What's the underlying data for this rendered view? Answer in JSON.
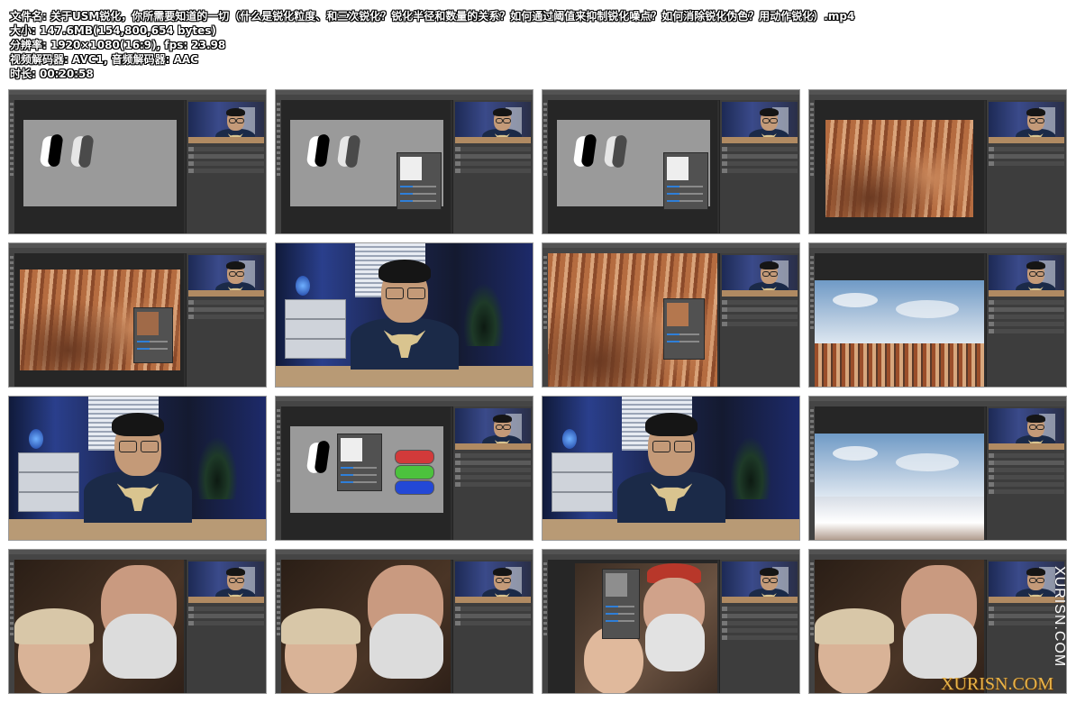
{
  "meta": {
    "filename": "文件名: 关于USM锐化，你所需要知道的一切（什么是锐化粒度、和三次锐化？锐化半径和数量的关系？如何通过阈值来抑制锐化噪点？如何消除锐化伪色？用动作锐化）.mp4",
    "size": "大小: 147.6MB(154,800,654 bytes)",
    "resolution": "分辨率: 1920×1080(16:9), fps: 23.98",
    "codec": "视频解码器: AVC1, 音频解码器: AAC",
    "duration": "时长: 00:20:58"
  },
  "thumbnails": [
    {
      "scene": "ps-shapes-gray"
    },
    {
      "scene": "ps-shapes-dialog"
    },
    {
      "scene": "ps-shapes-dialog"
    },
    {
      "scene": "ps-canyon-small"
    },
    {
      "scene": "ps-canyon-dialog"
    },
    {
      "scene": "presenter"
    },
    {
      "scene": "ps-canyon-zoom"
    },
    {
      "scene": "ps-sky-canyon"
    },
    {
      "scene": "presenter"
    },
    {
      "scene": "ps-shapes-color"
    },
    {
      "scene": "presenter"
    },
    {
      "scene": "ps-sky-snow"
    },
    {
      "scene": "ps-couple"
    },
    {
      "scene": "ps-couple"
    },
    {
      "scene": "ps-couple-dialog"
    },
    {
      "scene": "ps-couple"
    }
  ],
  "watermark": {
    "vertical": "XURISN.COM",
    "logo": "XURISN.COM"
  }
}
